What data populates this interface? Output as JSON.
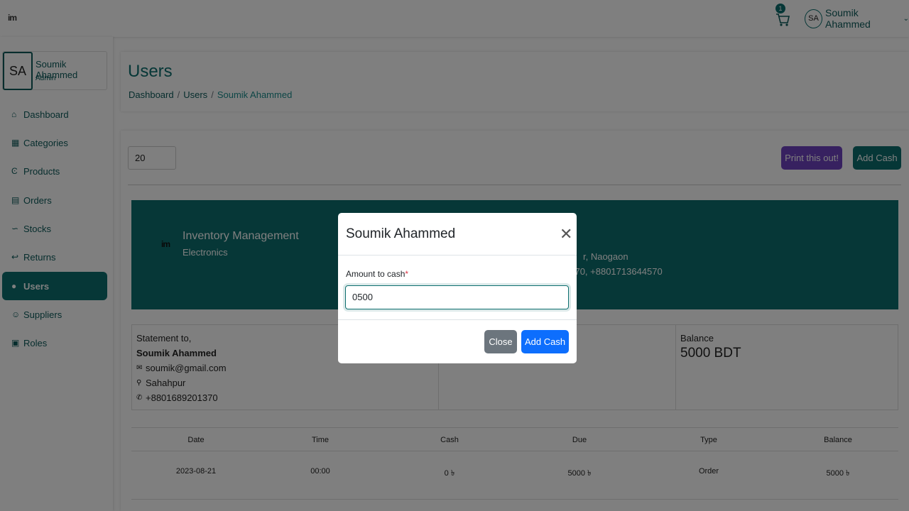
{
  "app": {
    "logo": "im"
  },
  "topbar": {
    "cart_count": "1",
    "user_initials": "SA",
    "user_name": "Soumik Ahammed"
  },
  "sidebar": {
    "profile": {
      "initials": "SA",
      "name": "Soumik Ahammed",
      "role": "Admin"
    },
    "items": [
      {
        "label": "Dashboard",
        "icon": "home-icon"
      },
      {
        "label": "Categories",
        "icon": "grid-icon"
      },
      {
        "label": "Products",
        "icon": "cart-icon"
      },
      {
        "label": "Orders",
        "icon": "receipt-icon"
      },
      {
        "label": "Stocks",
        "icon": "chart-line-icon"
      },
      {
        "label": "Returns",
        "icon": "arrow-left-icon"
      },
      {
        "label": "Users",
        "icon": "users-icon",
        "active": true
      },
      {
        "label": "Suppliers",
        "icon": "person-icon"
      },
      {
        "label": "Roles",
        "icon": "table-icon"
      }
    ]
  },
  "page": {
    "title": "Users",
    "breadcrumb": [
      "Dashboard",
      "Users",
      "Soumik Ahammed"
    ]
  },
  "toolbar": {
    "per_page": "20",
    "print_label": "Print this out!",
    "add_cash_label": "Add Cash"
  },
  "banner": {
    "logo": "im",
    "company": "Inventory Management",
    "category": "Electronics",
    "address_partial": "r, Naogaon",
    "phones_partial": "1370, +8801713644570"
  },
  "statement": {
    "label": "Statement to,",
    "name": "Soumik Ahammed",
    "email": "soumik@gmail.com",
    "location": "Sahahpur",
    "phone": "+8801689201370",
    "balance_label": "Balance",
    "balance_value": "5000 BDT"
  },
  "transactions": {
    "headers": [
      "Date",
      "Time",
      "Cash",
      "Due",
      "Type",
      "Balance"
    ],
    "rows": [
      [
        "2023-08-21",
        "00:00",
        "0 ৳",
        "5000 ৳",
        "Order",
        "5000 ৳"
      ]
    ]
  },
  "modal": {
    "title": "Soumik Ahammed",
    "field_label": "Amount to cash",
    "required_mark": "*",
    "field_value": "0500",
    "close_label": "Close",
    "submit_label": "Add Cash"
  },
  "colors": {
    "primary": "#0d6e6e",
    "print_button": "#6f42c1",
    "submit_button": "#0d6efd",
    "close_button": "#6c757d"
  }
}
